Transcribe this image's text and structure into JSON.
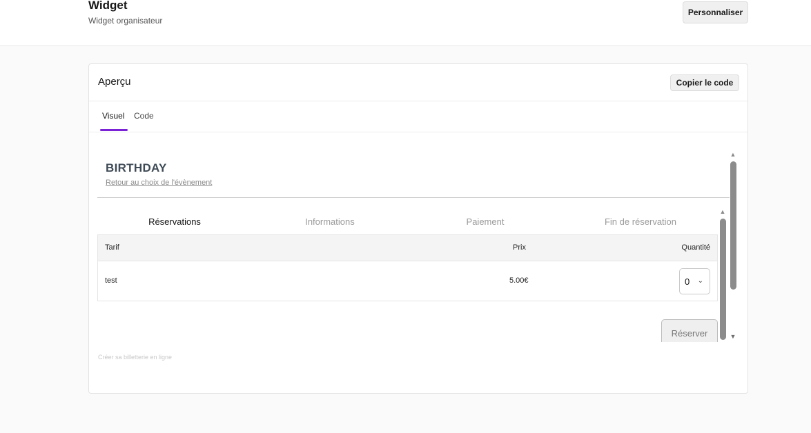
{
  "header": {
    "title": "Widget",
    "subtitle": "Widget organisateur",
    "customize_label": "Personnaliser"
  },
  "card": {
    "title": "Aperçu",
    "copy_label": "Copier le code",
    "tabs": [
      {
        "label": "Visuel",
        "active": true
      },
      {
        "label": "Code",
        "active": false
      }
    ]
  },
  "preview": {
    "event_title": "BIRTHDAY",
    "back_link": "Retour au choix de l'évènement",
    "steps": [
      {
        "label": "Réservations",
        "active": true
      },
      {
        "label": "Informations",
        "active": false
      },
      {
        "label": "Paiement",
        "active": false
      },
      {
        "label": "Fin de réservation",
        "active": false
      }
    ],
    "table": {
      "headers": {
        "tarif": "Tarif",
        "prix": "Prix",
        "quantite": "Quantité"
      },
      "rows": [
        {
          "name": "test",
          "price": "5.00€",
          "quantity": "0"
        }
      ]
    },
    "reserve_label": "Réserver",
    "footer_link": "Créer sa billetterie en ligne"
  },
  "colors": {
    "accent": "#7c22d6",
    "event_title": "#3e4a55"
  },
  "icons": {
    "scroll_up": "triangle-up-icon",
    "scroll_down": "triangle-down-icon",
    "select_chevron": "chevron-down-icon"
  }
}
